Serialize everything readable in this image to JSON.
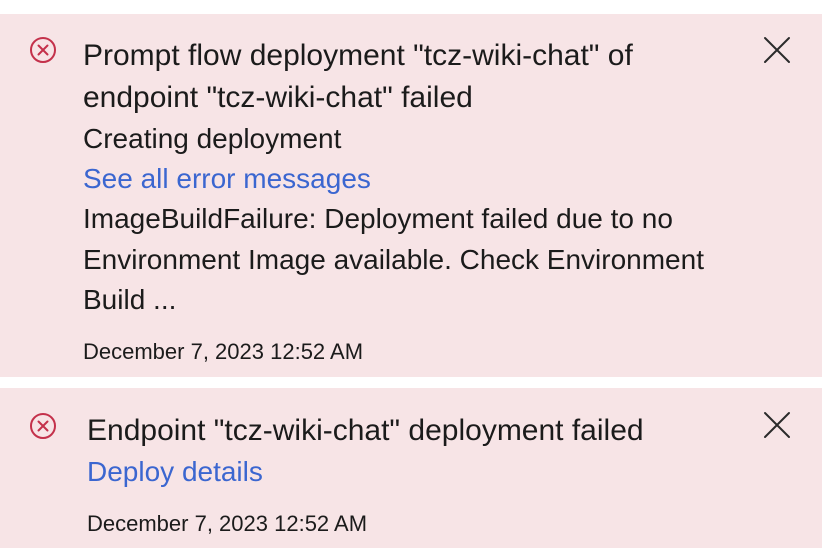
{
  "colors": {
    "toast_background": "#f7e4e6",
    "error_icon": "#c4314b",
    "link": "#3b66d0",
    "text": "#1b1b1b"
  },
  "notifications": [
    {
      "icon": "error-circle-icon",
      "title": "Prompt flow deployment \"tcz-wiki-chat\" of endpoint \"tcz-wiki-chat\" failed",
      "status": "Creating deployment",
      "link_label": "See all error messages",
      "error_message": "ImageBuildFailure: Deployment failed due to no Environment Image available. Check Environment Build ...",
      "timestamp": "December 7, 2023 12:52 AM",
      "close_icon": "close-icon"
    },
    {
      "icon": "error-circle-icon",
      "title": "Endpoint \"tcz-wiki-chat\" deployment failed",
      "link_label": "Deploy details",
      "timestamp": "December 7, 2023 12:52 AM",
      "close_icon": "close-icon"
    }
  ]
}
